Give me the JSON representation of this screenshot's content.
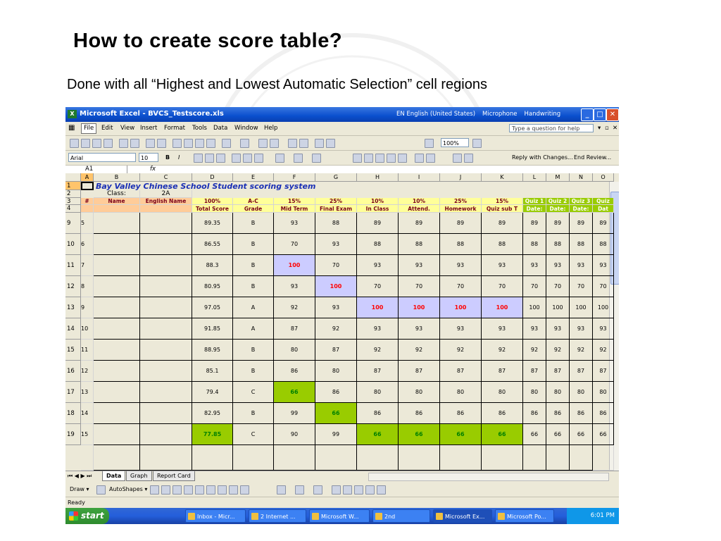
{
  "slide": {
    "title": "How to create score table?",
    "subtitle": "Done with all “Highest and Lowest Automatic Selection” cell regions"
  },
  "excel": {
    "window_title": "Microsoft Excel - BVCS_Testscore.xls",
    "language_bar": [
      "EN English (United States)",
      "Microphone",
      "Handwriting"
    ],
    "menu": [
      "File",
      "Edit",
      "View",
      "Insert",
      "Format",
      "Tools",
      "Data",
      "Window",
      "Help"
    ],
    "help_placeholder": "Type a question for help",
    "zoom": "100%",
    "font_name": "Arial",
    "font_size": "10",
    "reply_text": "Reply with Changes...",
    "end_review": "End Review...",
    "name_box": "A1",
    "fx": "fx",
    "columns": [
      "A",
      "B",
      "C",
      "D",
      "E",
      "F",
      "G",
      "H",
      "I",
      "J",
      "K",
      "L",
      "M",
      "N",
      "O"
    ],
    "title_row": {
      "row": "1",
      "text": "Bay Valley Chinese School Student scoring system"
    },
    "class_row": {
      "row": "2",
      "label": "Class:",
      "value": "2A"
    },
    "weights_row": {
      "row": "3",
      "cells": [
        "#",
        "Name",
        "English Name",
        "100%",
        "A-C",
        "15%",
        "25%",
        "10%",
        "10%",
        "25%",
        "15%",
        "Quiz 1",
        "Quiz 2",
        "Quiz 3",
        "Quiz"
      ]
    },
    "labels_row": {
      "row": "4",
      "cells": [
        "",
        "",
        "",
        "Total Score",
        "Grade",
        "Mid Term",
        "Final Exam",
        "In Class",
        "Attend.",
        "Homework",
        "Quiz sub T",
        "Date:",
        "Date:",
        "Date:",
        "Dat"
      ]
    },
    "rows": [
      {
        "row": "9",
        "n": "5",
        "vals": [
          "89.35",
          "B",
          "93",
          "88",
          "89",
          "89",
          "89",
          "89",
          "89",
          "89",
          "89",
          "89"
        ]
      },
      {
        "row": "10",
        "n": "6",
        "vals": [
          "86.55",
          "B",
          "70",
          "93",
          "88",
          "88",
          "88",
          "88",
          "88",
          "88",
          "88",
          "88"
        ]
      },
      {
        "row": "11",
        "n": "7",
        "vals": [
          "88.3",
          "B",
          "100",
          "70",
          "93",
          "93",
          "93",
          "93",
          "93",
          "93",
          "93",
          "93"
        ]
      },
      {
        "row": "12",
        "n": "8",
        "vals": [
          "80.95",
          "B",
          "93",
          "100",
          "70",
          "70",
          "70",
          "70",
          "70",
          "70",
          "70",
          "70"
        ]
      },
      {
        "row": "13",
        "n": "9",
        "vals": [
          "97.05",
          "A",
          "92",
          "93",
          "100",
          "100",
          "100",
          "100",
          "100",
          "100",
          "100",
          "100"
        ]
      },
      {
        "row": "14",
        "n": "10",
        "vals": [
          "91.85",
          "A",
          "87",
          "92",
          "93",
          "93",
          "93",
          "93",
          "93",
          "93",
          "93",
          "93"
        ]
      },
      {
        "row": "15",
        "n": "11",
        "vals": [
          "88.95",
          "B",
          "80",
          "87",
          "92",
          "92",
          "92",
          "92",
          "92",
          "92",
          "92",
          "92"
        ]
      },
      {
        "row": "16",
        "n": "12",
        "vals": [
          "85.1",
          "B",
          "86",
          "80",
          "87",
          "87",
          "87",
          "87",
          "87",
          "87",
          "87",
          "87"
        ]
      },
      {
        "row": "17",
        "n": "13",
        "vals": [
          "79.4",
          "C",
          "66",
          "86",
          "80",
          "80",
          "80",
          "80",
          "80",
          "80",
          "80",
          "80"
        ]
      },
      {
        "row": "18",
        "n": "14",
        "vals": [
          "82.95",
          "B",
          "99",
          "66",
          "86",
          "86",
          "86",
          "86",
          "86",
          "86",
          "86",
          "86"
        ]
      },
      {
        "row": "19",
        "n": "15",
        "vals": [
          "77.85",
          "C",
          "90",
          "99",
          "66",
          "66",
          "66",
          "66",
          "66",
          "66",
          "66",
          "66"
        ]
      }
    ],
    "highlight_colors": {
      "high": "#ccccff",
      "high_text": "#ff0000",
      "low": "#99cc00",
      "low_text": "#008000"
    },
    "sheet_tabs": [
      "Data",
      "Graph",
      "Report Card"
    ],
    "draw_label": "Draw ▾",
    "autoshapes_label": "AutoShapes ▾",
    "status": "Ready",
    "taskbar": {
      "start": "start",
      "buttons": [
        "Inbox - Micr...",
        "2 Internet ...",
        "Microsoft W...",
        "2nd",
        "Microsoft Ex...",
        "Microsoft Po..."
      ],
      "clock": "6:01 PM"
    }
  }
}
